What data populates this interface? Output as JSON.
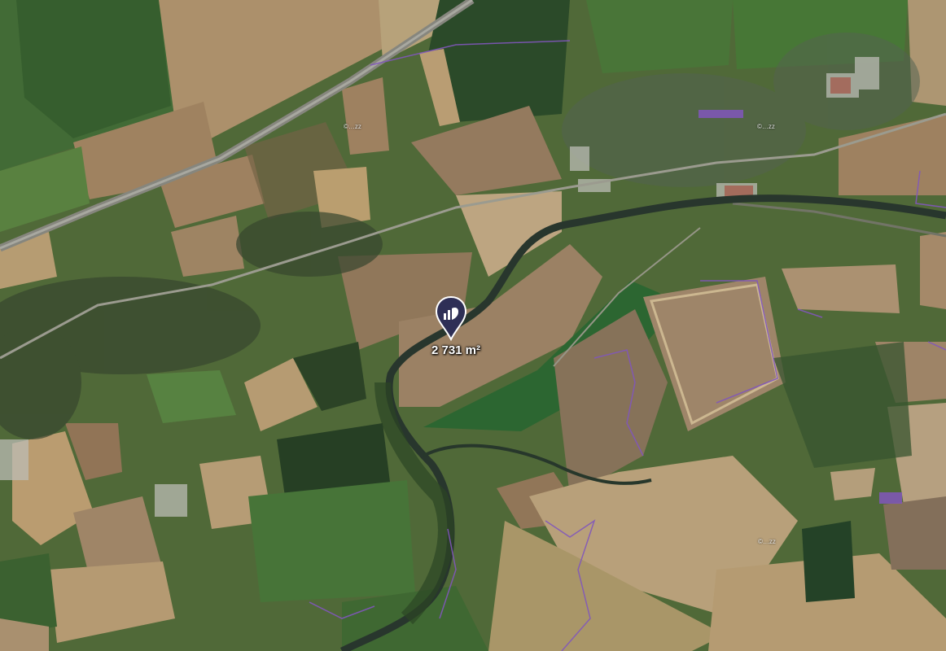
{
  "map": {
    "imagery": "satellite",
    "marker": {
      "icon": "parcel-pin-icon",
      "color": "#2e2f56",
      "area_label": "2 731 m²"
    },
    "watermarks": [
      "©…zz",
      "©…zz",
      "©…zz"
    ],
    "colors": {
      "field_light": "#b39c70",
      "field_dark": "#8d7558",
      "grass": "#4f7a3a",
      "forest": "#2f4a26",
      "river": "#2a3b2e",
      "boundary": "#8a5cc8",
      "road": "#9a9a8c"
    }
  }
}
